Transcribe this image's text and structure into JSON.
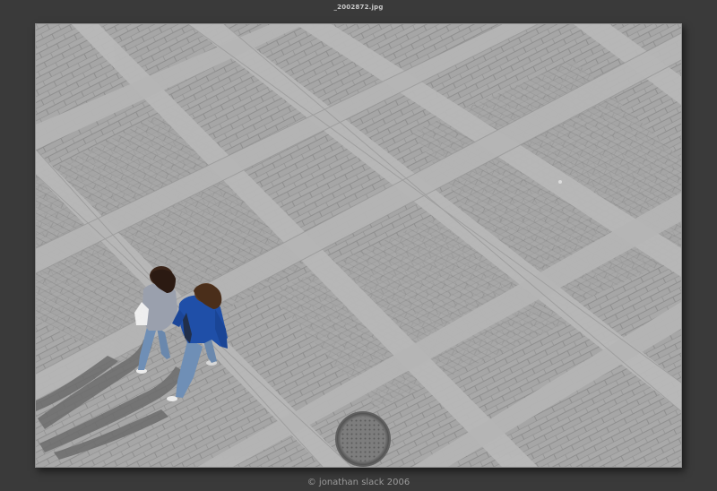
{
  "window": {
    "title": "_2002872.jpg"
  },
  "photo": {
    "palette": {
      "pavement": "#a3a3a3",
      "brick_line": "#8f8f8f",
      "slab": "#b9b9b9",
      "shadow": "#6c6c6c",
      "jacket_blue": "#1f4fa8",
      "jeans": "#6f8fb6",
      "grey_top": "#9aa0ad",
      "hair": "#3a2418"
    }
  },
  "footer": {
    "credit": "© jonathan slack 2006"
  }
}
